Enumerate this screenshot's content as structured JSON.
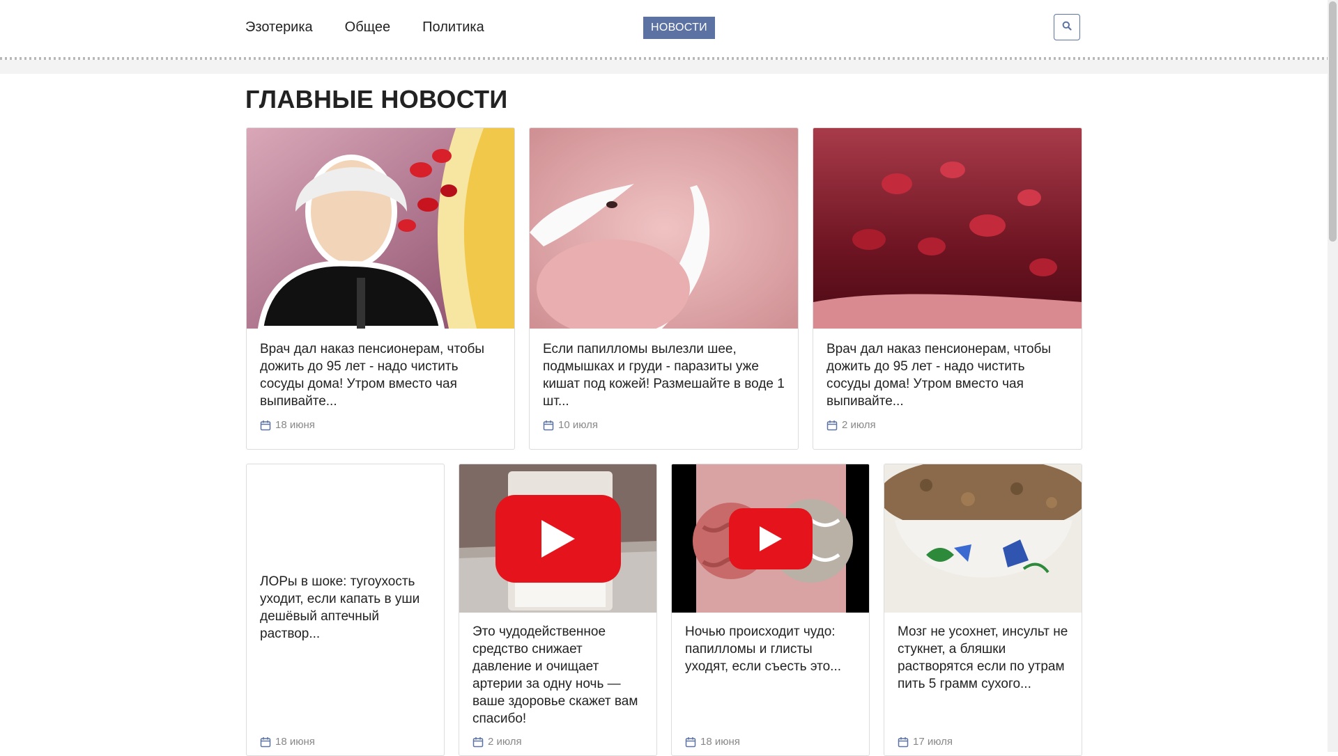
{
  "header": {
    "nav": [
      "Эзотерика",
      "Общее",
      "Политика"
    ],
    "news_button": "НОВОСТИ",
    "search_icon": "search-icon"
  },
  "section_title": "ГЛАВНЫЕ НОВОСТИ",
  "cards_top": [
    {
      "title": "Врач дал наказ пенсионерам, чтобы дожить до 95 лет - надо чистить сосуды дома! Утром вместо чая выпивайте...",
      "date": "18 июня"
    },
    {
      "title": "Если папилломы вылезли шее, подмышках и груди - паразиты уже кишат под кожей! Размешайте в воде 1 шт...",
      "date": "10 июля"
    },
    {
      "title": "Врач дал наказ пенсионерам, чтобы дожить до 95 лет - надо чистить сосуды дома! Утром вместо чая выпивайте...",
      "date": "2 июля"
    }
  ],
  "cards_bottom": [
    {
      "title": "ЛОРы в шоке: тугоухость уходит, если капать в уши дешёвый аптечный раствор...",
      "date": "18 июня"
    },
    {
      "title": "Это чудодейственное средство снижает давление и очищает артерии за одну ночь — ваше здоровье скажет вам спасибо!",
      "date": "2 июля"
    },
    {
      "title": "Ночью происходит чудо: папилломы и глисты уходят, если съесть это...",
      "date": "18 июня"
    },
    {
      "title": "Мозг не усохнет, инсульт не стукнет, а бляшки растворятся если по утрам пить 5 грамм сухого...",
      "date": "17 июля"
    }
  ],
  "colors": {
    "accent": "#5b72a3",
    "youtube_red": "#e5141c"
  }
}
